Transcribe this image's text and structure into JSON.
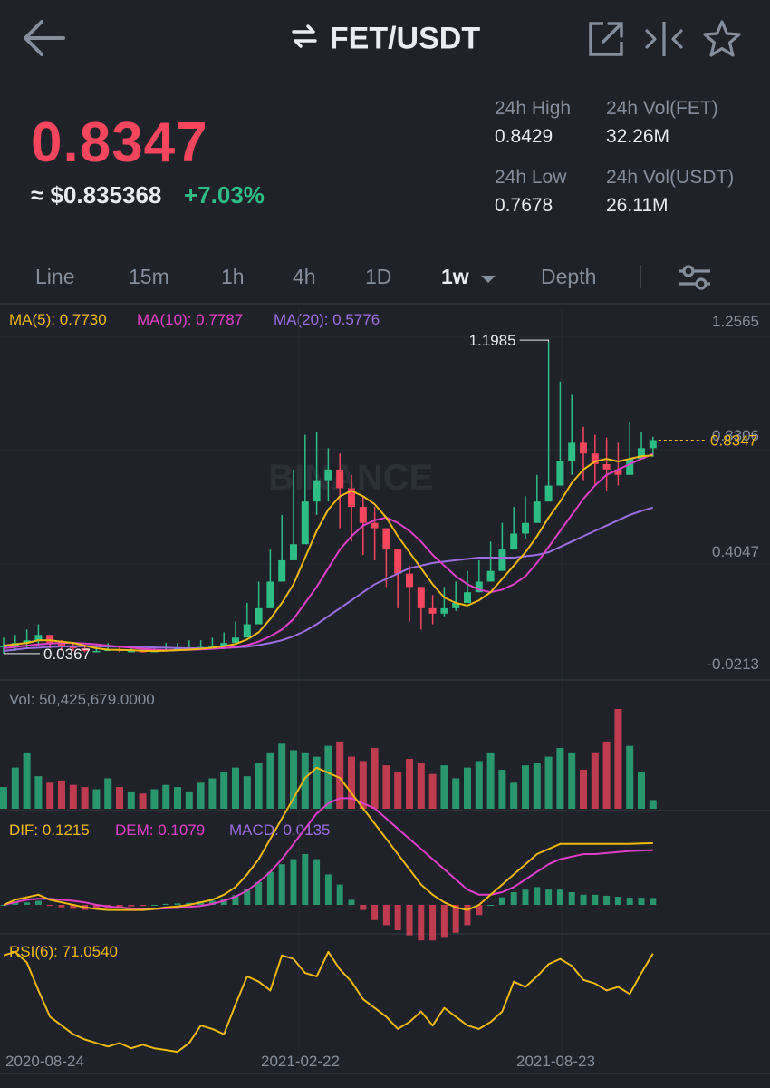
{
  "header": {
    "pair": "FET/USDT",
    "icons": [
      "back-arrow-icon",
      "swap-icon",
      "external-link-icon",
      "split-view-icon",
      "star-icon"
    ]
  },
  "ticker": {
    "last_price": "0.8347",
    "fiat_price": "≈ $0.835368",
    "change_pct": "+7.03%",
    "high_label": "24h High",
    "high_value": "0.8429",
    "vol_base_label": "24h Vol(FET)",
    "vol_base_value": "32.26M",
    "low_label": "24h Low",
    "low_value": "0.7678",
    "vol_quote_label": "24h Vol(USDT)",
    "vol_quote_value": "26.11M"
  },
  "tabs": [
    {
      "label": "Line"
    },
    {
      "label": "15m"
    },
    {
      "label": "1h"
    },
    {
      "label": "4h"
    },
    {
      "label": "1D"
    },
    {
      "label": "1w",
      "active": true
    },
    {
      "label": "Depth"
    }
  ],
  "colors": {
    "up": "#2ebd85",
    "down": "#f6465d",
    "ma5": "#f0b90b",
    "ma10": "#e040c8",
    "ma20": "#9c6ee0",
    "bg": "#1f2229"
  },
  "chart_data": [
    {
      "type": "candlestick",
      "interval": "1w",
      "legend": {
        "ma5": "MA(5): 0.7730",
        "ma10": "MA(10): 0.7787",
        "ma20": "MA(20): 0.5776"
      },
      "y_ticks": [
        "1.2565",
        "0.8306",
        "0.4047",
        "-0.0213"
      ],
      "ylim": [
        -0.0213,
        1.2565
      ],
      "max_label": "1.1985",
      "min_label": "0.0367",
      "last_label": "0.8347",
      "watermark": "BINANCE",
      "closes": [
        0.06,
        0.07,
        0.08,
        0.1,
        0.07,
        0.06,
        0.05,
        0.04,
        0.04,
        0.045,
        0.04,
        0.04,
        0.038,
        0.04,
        0.045,
        0.05,
        0.05,
        0.055,
        0.06,
        0.07,
        0.09,
        0.14,
        0.2,
        0.3,
        0.38,
        0.44,
        0.6,
        0.68,
        0.72,
        0.65,
        0.58,
        0.52,
        0.5,
        0.42,
        0.33,
        0.28,
        0.2,
        0.18,
        0.2,
        0.22,
        0.26,
        0.3,
        0.34,
        0.42,
        0.48,
        0.52,
        0.6,
        0.66,
        0.75,
        0.82,
        0.78,
        0.74,
        0.72,
        0.7,
        0.76,
        0.8,
        0.83
      ],
      "highs": [
        0.09,
        0.1,
        0.12,
        0.14,
        0.1,
        0.08,
        0.07,
        0.06,
        0.06,
        0.07,
        0.06,
        0.06,
        0.055,
        0.06,
        0.07,
        0.07,
        0.08,
        0.08,
        0.09,
        0.11,
        0.15,
        0.22,
        0.3,
        0.42,
        0.55,
        0.72,
        0.85,
        0.86,
        0.8,
        0.78,
        0.7,
        0.62,
        0.58,
        0.5,
        0.42,
        0.36,
        0.28,
        0.25,
        0.28,
        0.3,
        0.34,
        0.38,
        0.45,
        0.52,
        0.58,
        0.62,
        0.7,
        1.1985,
        1.05,
        1.0,
        0.88,
        0.85,
        0.84,
        0.82,
        0.9,
        0.86,
        0.8429
      ],
      "lows": [
        0.03,
        0.04,
        0.05,
        0.06,
        0.05,
        0.04,
        0.04,
        0.035,
        0.0367,
        0.04,
        0.035,
        0.035,
        0.034,
        0.035,
        0.04,
        0.045,
        0.045,
        0.05,
        0.055,
        0.06,
        0.08,
        0.12,
        0.18,
        0.25,
        0.32,
        0.38,
        0.5,
        0.55,
        0.6,
        0.5,
        0.45,
        0.4,
        0.38,
        0.28,
        0.2,
        0.15,
        0.12,
        0.14,
        0.17,
        0.19,
        0.22,
        0.26,
        0.3,
        0.36,
        0.42,
        0.46,
        0.54,
        0.62,
        0.66,
        0.7,
        0.68,
        0.66,
        0.64,
        0.66,
        0.7,
        0.76,
        0.7678
      ],
      "ma5": [
        0.06,
        0.065,
        0.07,
        0.08,
        0.08,
        0.075,
        0.07,
        0.06,
        0.05,
        0.045,
        0.044,
        0.043,
        0.041,
        0.04,
        0.041,
        0.043,
        0.045,
        0.048,
        0.052,
        0.058,
        0.066,
        0.083,
        0.11,
        0.16,
        0.22,
        0.29,
        0.39,
        0.49,
        0.57,
        0.62,
        0.64,
        0.62,
        0.59,
        0.54,
        0.47,
        0.41,
        0.35,
        0.29,
        0.24,
        0.22,
        0.21,
        0.23,
        0.26,
        0.31,
        0.36,
        0.41,
        0.47,
        0.54,
        0.6,
        0.67,
        0.72,
        0.75,
        0.76,
        0.75,
        0.76,
        0.77,
        0.773
      ],
      "ma10": [
        0.05,
        0.055,
        0.06,
        0.065,
        0.068,
        0.07,
        0.07,
        0.068,
        0.065,
        0.06,
        0.056,
        0.052,
        0.048,
        0.045,
        0.043,
        0.043,
        0.044,
        0.046,
        0.048,
        0.051,
        0.055,
        0.062,
        0.075,
        0.095,
        0.12,
        0.16,
        0.22,
        0.28,
        0.35,
        0.42,
        0.47,
        0.51,
        0.53,
        0.54,
        0.52,
        0.49,
        0.45,
        0.4,
        0.36,
        0.32,
        0.29,
        0.27,
        0.26,
        0.27,
        0.29,
        0.32,
        0.37,
        0.43,
        0.49,
        0.55,
        0.61,
        0.66,
        0.7,
        0.72,
        0.74,
        0.76,
        0.7787
      ],
      "ma20": [
        0.04,
        0.045,
        0.05,
        0.052,
        0.055,
        0.057,
        0.058,
        0.058,
        0.058,
        0.057,
        0.056,
        0.055,
        0.054,
        0.053,
        0.052,
        0.051,
        0.05,
        0.05,
        0.05,
        0.051,
        0.053,
        0.056,
        0.062,
        0.07,
        0.08,
        0.095,
        0.115,
        0.14,
        0.17,
        0.2,
        0.23,
        0.26,
        0.29,
        0.31,
        0.33,
        0.35,
        0.36,
        0.37,
        0.375,
        0.38,
        0.385,
        0.39,
        0.39,
        0.39,
        0.39,
        0.395,
        0.4,
        0.41,
        0.43,
        0.45,
        0.47,
        0.49,
        0.51,
        0.53,
        0.55,
        0.565,
        0.5776
      ]
    },
    {
      "type": "bar",
      "legend": "Vol: 50,425,679.0000",
      "volumes": [
        20,
        38,
        52,
        30,
        24,
        26,
        22,
        20,
        18,
        28,
        20,
        16,
        14,
        18,
        22,
        20,
        16,
        24,
        28,
        34,
        38,
        30,
        42,
        52,
        60,
        54,
        52,
        48,
        58,
        62,
        48,
        44,
        56,
        40,
        34,
        46,
        42,
        32,
        40,
        28,
        38,
        44,
        52,
        36,
        24,
        40,
        42,
        48,
        56,
        52,
        36,
        52,
        62,
        92,
        58,
        34,
        8
      ]
    },
    {
      "type": "line",
      "legend": {
        "dif": "DIF: 0.1215",
        "dem": "DEM: 0.1079",
        "macd": "MACD: 0.0135"
      },
      "dif": [
        0.0,
        0.01,
        0.015,
        0.02,
        0.01,
        0.005,
        0.0,
        -0.005,
        -0.008,
        -0.01,
        -0.01,
        -0.01,
        -0.01,
        -0.008,
        -0.005,
        -0.003,
        0.0,
        0.005,
        0.01,
        0.02,
        0.035,
        0.06,
        0.09,
        0.13,
        0.17,
        0.21,
        0.25,
        0.27,
        0.26,
        0.25,
        0.22,
        0.19,
        0.16,
        0.13,
        0.1,
        0.07,
        0.04,
        0.02,
        0.005,
        -0.005,
        -0.01,
        0.0,
        0.02,
        0.04,
        0.06,
        0.08,
        0.1,
        0.11,
        0.12,
        0.12,
        0.12,
        0.12,
        0.12,
        0.12,
        0.12,
        0.121,
        0.1215
      ],
      "dem": [
        0.0,
        0.005,
        0.01,
        0.012,
        0.012,
        0.01,
        0.008,
        0.005,
        0.0,
        -0.003,
        -0.005,
        -0.007,
        -0.008,
        -0.008,
        -0.007,
        -0.006,
        -0.004,
        -0.002,
        0.002,
        0.008,
        0.016,
        0.028,
        0.045,
        0.065,
        0.09,
        0.12,
        0.15,
        0.18,
        0.2,
        0.21,
        0.21,
        0.2,
        0.19,
        0.17,
        0.15,
        0.13,
        0.11,
        0.09,
        0.07,
        0.05,
        0.03,
        0.02,
        0.02,
        0.025,
        0.035,
        0.05,
        0.065,
        0.08,
        0.09,
        0.095,
        0.1,
        0.1,
        0.102,
        0.104,
        0.106,
        0.107,
        0.1079
      ],
      "macd": [
        0.0,
        0.005,
        0.005,
        0.008,
        -0.002,
        -0.005,
        -0.008,
        -0.01,
        -0.008,
        -0.007,
        -0.005,
        -0.003,
        -0.002,
        0.0,
        0.002,
        0.003,
        0.004,
        0.007,
        0.008,
        0.012,
        0.019,
        0.032,
        0.045,
        0.065,
        0.08,
        0.09,
        0.1,
        0.09,
        0.06,
        0.04,
        0.01,
        -0.01,
        -0.03,
        -0.04,
        -0.05,
        -0.06,
        -0.07,
        -0.07,
        -0.065,
        -0.055,
        -0.04,
        -0.02,
        0.0,
        0.015,
        0.025,
        0.03,
        0.035,
        0.03,
        0.03,
        0.025,
        0.02,
        0.02,
        0.018,
        0.016,
        0.014,
        0.014,
        0.0135
      ]
    },
    {
      "type": "line",
      "legend": "RSI(6): 71.0540",
      "rsi": [
        70,
        72,
        66,
        50,
        35,
        30,
        25,
        22,
        20,
        18,
        20,
        17,
        19,
        17,
        16,
        15,
        20,
        30,
        28,
        25,
        42,
        58,
        55,
        50,
        70,
        68,
        60,
        58,
        72,
        62,
        55,
        45,
        40,
        35,
        28,
        32,
        38,
        30,
        40,
        35,
        30,
        28,
        32,
        38,
        55,
        52,
        58,
        65,
        68,
        64,
        56,
        54,
        50,
        52,
        48,
        60,
        71.054
      ],
      "x_labels": [
        "2020-08-24",
        "2021-02-22",
        "2021-08-23"
      ]
    }
  ]
}
